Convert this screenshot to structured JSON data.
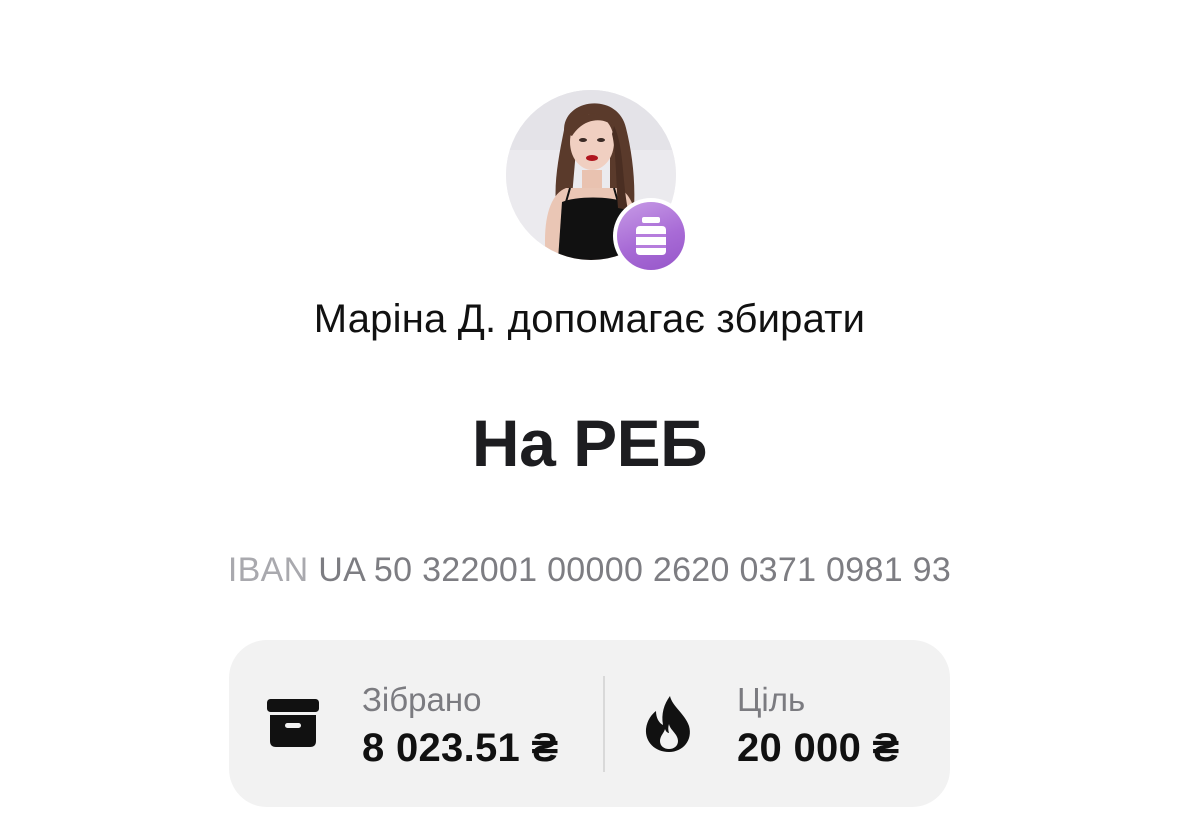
{
  "profile": {
    "collector_text": "Маріна Д. допомагає збирати",
    "avatar_icon": "user-photo",
    "badge_icon": "jar-icon"
  },
  "jar": {
    "title": "На РЕБ",
    "iban_label": "IBAN",
    "iban_number": "UA 50 322001 00000 2620 0371 0981 93"
  },
  "stats": {
    "collected": {
      "icon": "archive-box-icon",
      "label": "Зібрано",
      "value": "8 023.51 ₴"
    },
    "goal": {
      "icon": "flame-icon",
      "label": "Ціль",
      "value": "20 000 ₴"
    }
  },
  "colors": {
    "badge_purple": "#a86bd6",
    "card_background": "#f2f2f2",
    "muted_text": "#7b7b80"
  }
}
